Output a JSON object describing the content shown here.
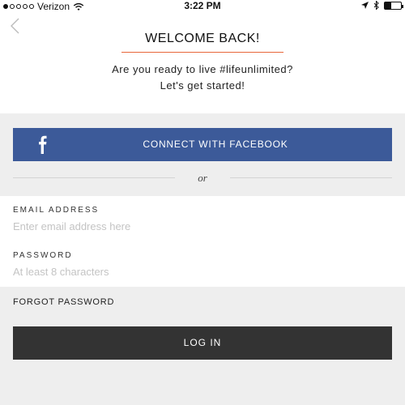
{
  "status_bar": {
    "carrier": "Verizon",
    "time": "3:22 PM",
    "signal_dots": [
      true,
      false,
      false,
      false,
      false
    ],
    "battery_level": 0.4
  },
  "header": {
    "back_icon": "chevron-left-icon",
    "title": "WELCOME BACK!",
    "subtitle_line1": "Are you ready to live #lifeunlimited?",
    "subtitle_line2": "Let's get started!"
  },
  "facebook": {
    "label": "CONNECT WITH FACEBOOK",
    "icon": "facebook-icon",
    "color": "#3c5a99"
  },
  "divider": {
    "text": "or"
  },
  "email": {
    "label": "EMAIL ADDRESS",
    "placeholder": "Enter email address here",
    "value": ""
  },
  "password": {
    "label": "PASSWORD",
    "placeholder": "At least 8 characters",
    "value": ""
  },
  "forgot_password": {
    "label": "FORGOT PASSWORD"
  },
  "login": {
    "label": "LOG IN",
    "color": "#333333"
  },
  "colors": {
    "accent": "#e8663a",
    "background": "#eeeeee"
  }
}
